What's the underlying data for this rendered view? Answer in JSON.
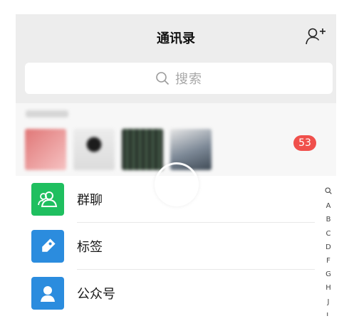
{
  "header": {
    "title": "通讯录",
    "add_friend_icon": "add-contact-icon"
  },
  "search": {
    "icon": "search-icon",
    "placeholder": "搜索"
  },
  "new_friends": {
    "badge_count": "53",
    "badge_color": "#f0504c",
    "avatar_count": 4
  },
  "menu": {
    "items": [
      {
        "label": "群聊",
        "icon": "group-chat-icon",
        "color": "#1fbf5f"
      },
      {
        "label": "标签",
        "icon": "tag-icon",
        "color": "#2b8cde"
      },
      {
        "label": "公众号",
        "icon": "official-account-icon",
        "color": "#2b8cde"
      }
    ]
  },
  "index_bar": {
    "items": [
      "A",
      "B",
      "C",
      "D",
      "F",
      "G",
      "H",
      "J",
      "L"
    ],
    "search_icon": "search-icon"
  }
}
